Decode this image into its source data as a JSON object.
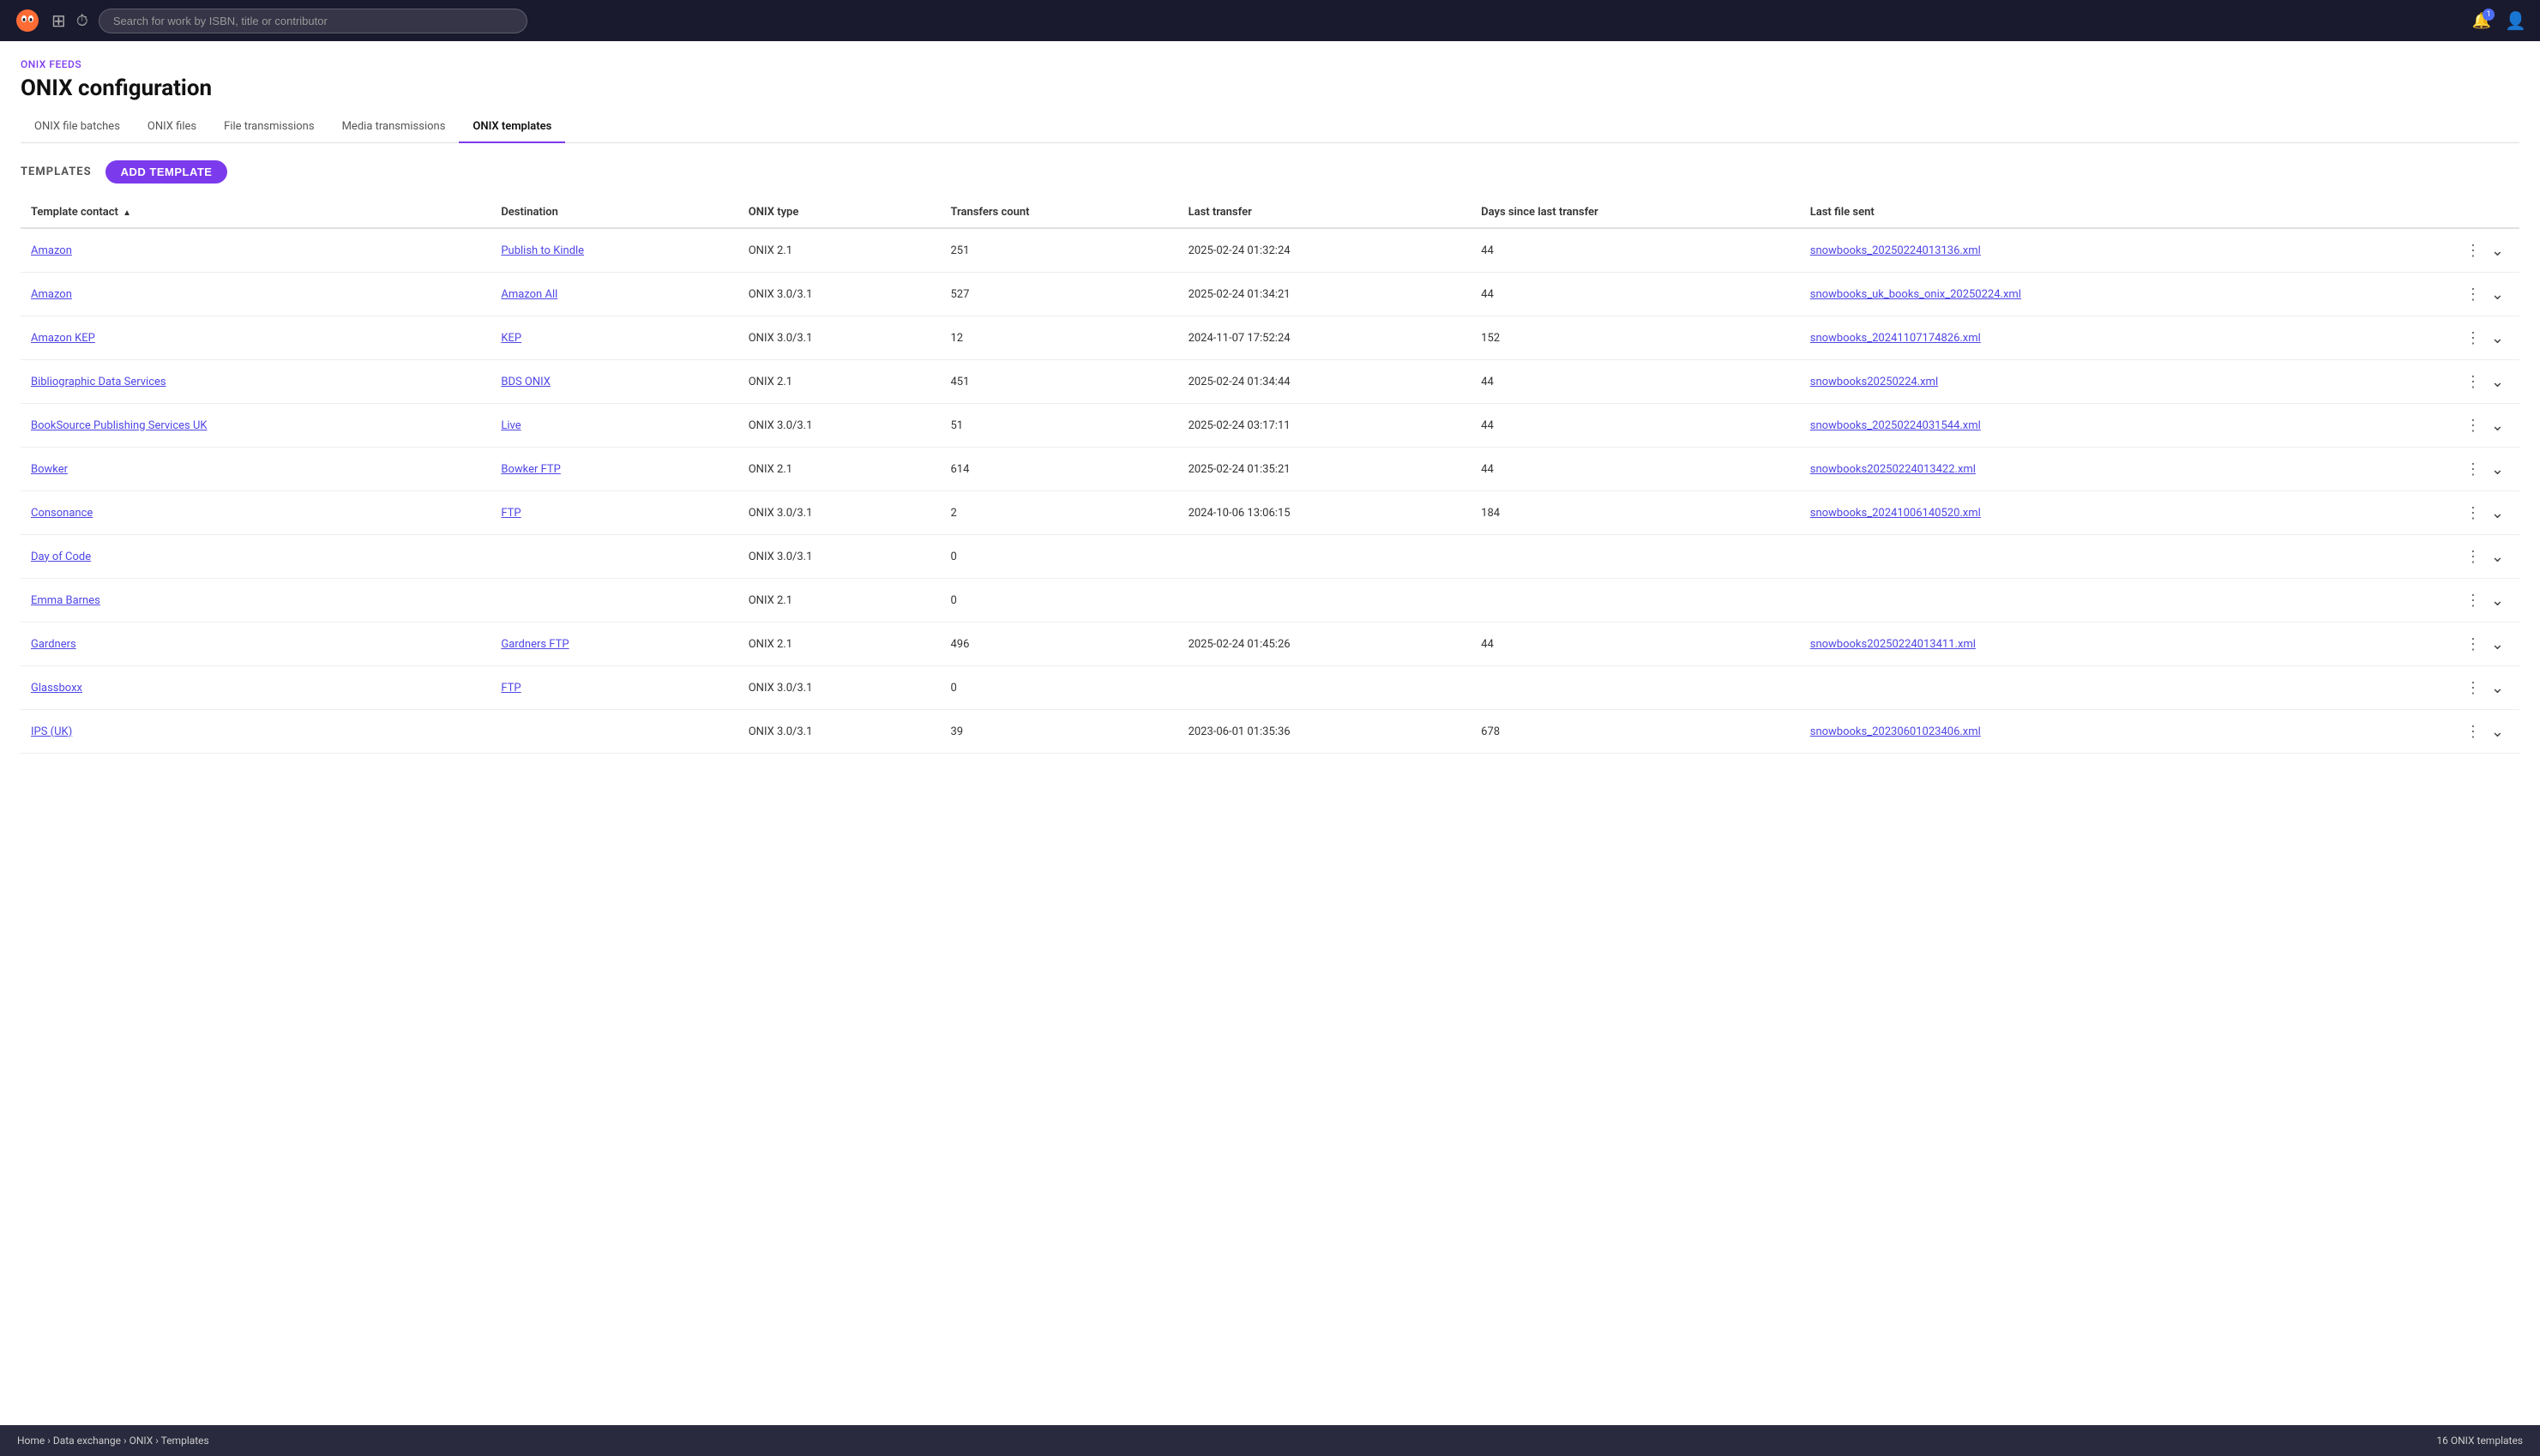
{
  "topNav": {
    "searchPlaceholder": "Search for work by ISBN, title or contributor",
    "bellBadge": "1"
  },
  "breadcrumb": "ONIX FEEDS",
  "pageTitle": "ONIX configuration",
  "subTabs": [
    {
      "label": "ONIX file batches",
      "active": false
    },
    {
      "label": "ONIX files",
      "active": false
    },
    {
      "label": "File transmissions",
      "active": false
    },
    {
      "label": "Media transmissions",
      "active": false
    },
    {
      "label": "ONIX templates",
      "active": true
    }
  ],
  "section": {
    "label": "TEMPLATES",
    "addButton": "ADD TEMPLATE"
  },
  "table": {
    "columns": [
      {
        "key": "contact",
        "label": "Template contact",
        "sortable": true
      },
      {
        "key": "destination",
        "label": "Destination"
      },
      {
        "key": "onixType",
        "label": "ONIX type"
      },
      {
        "key": "transfersCount",
        "label": "Transfers count"
      },
      {
        "key": "lastTransfer",
        "label": "Last transfer"
      },
      {
        "key": "daysSince",
        "label": "Days since last transfer"
      },
      {
        "key": "lastFileSent",
        "label": "Last file sent"
      }
    ],
    "rows": [
      {
        "contact": "Amazon",
        "contactLink": true,
        "destination": "Publish to Kindle",
        "destinationLink": true,
        "onixType": "ONIX 2.1",
        "transfersCount": "251",
        "lastTransfer": "2025-02-24 01:32:24",
        "daysSince": "44",
        "lastFileSent": "snowbooks_20250224013136.xml",
        "lastFileSentLink": true
      },
      {
        "contact": "Amazon",
        "contactLink": true,
        "destination": "Amazon All",
        "destinationLink": true,
        "onixType": "ONIX 3.0/3.1",
        "transfersCount": "527",
        "lastTransfer": "2025-02-24 01:34:21",
        "daysSince": "44",
        "lastFileSent": "snowbooks_uk_books_onix_20250224.xml",
        "lastFileSentLink": true
      },
      {
        "contact": "Amazon KEP",
        "contactLink": true,
        "destination": "KEP",
        "destinationLink": true,
        "onixType": "ONIX 3.0/3.1",
        "transfersCount": "12",
        "lastTransfer": "2024-11-07 17:52:24",
        "daysSince": "152",
        "lastFileSent": "snowbooks_20241107174826.xml",
        "lastFileSentLink": true
      },
      {
        "contact": "Bibliographic Data Services",
        "contactLink": true,
        "destination": "BDS ONIX",
        "destinationLink": true,
        "onixType": "ONIX 2.1",
        "transfersCount": "451",
        "lastTransfer": "2025-02-24 01:34:44",
        "daysSince": "44",
        "lastFileSent": "snowbooks20250224.xml",
        "lastFileSentLink": true
      },
      {
        "contact": "BookSource Publishing Services UK",
        "contactLink": true,
        "destination": "Live",
        "destinationLink": true,
        "onixType": "ONIX 3.0/3.1",
        "transfersCount": "51",
        "lastTransfer": "2025-02-24 03:17:11",
        "daysSince": "44",
        "lastFileSent": "snowbooks_20250224031544.xml",
        "lastFileSentLink": true
      },
      {
        "contact": "Bowker",
        "contactLink": true,
        "destination": "Bowker FTP",
        "destinationLink": true,
        "onixType": "ONIX 2.1",
        "transfersCount": "614",
        "lastTransfer": "2025-02-24 01:35:21",
        "daysSince": "44",
        "lastFileSent": "snowbooks20250224013422.xml",
        "lastFileSentLink": true
      },
      {
        "contact": "Consonance",
        "contactLink": true,
        "destination": "FTP",
        "destinationLink": true,
        "onixType": "ONIX 3.0/3.1",
        "transfersCount": "2",
        "lastTransfer": "2024-10-06 13:06:15",
        "daysSince": "184",
        "lastFileSent": "snowbooks_20241006140520.xml",
        "lastFileSentLink": true
      },
      {
        "contact": "Day of Code",
        "contactLink": true,
        "destination": "",
        "destinationLink": false,
        "onixType": "ONIX 3.0/3.1",
        "transfersCount": "0",
        "lastTransfer": "",
        "daysSince": "",
        "lastFileSent": "",
        "lastFileSentLink": false
      },
      {
        "contact": "Emma Barnes",
        "contactLink": true,
        "destination": "",
        "destinationLink": false,
        "onixType": "ONIX 2.1",
        "transfersCount": "0",
        "lastTransfer": "",
        "daysSince": "",
        "lastFileSent": "",
        "lastFileSentLink": false
      },
      {
        "contact": "Gardners",
        "contactLink": true,
        "destination": "Gardners FTP",
        "destinationLink": true,
        "onixType": "ONIX 2.1",
        "transfersCount": "496",
        "lastTransfer": "2025-02-24 01:45:26",
        "daysSince": "44",
        "lastFileSent": "snowbooks20250224013411.xml",
        "lastFileSentLink": true
      },
      {
        "contact": "Glassboxx",
        "contactLink": true,
        "destination": "FTP",
        "destinationLink": true,
        "onixType": "ONIX 3.0/3.1",
        "transfersCount": "0",
        "lastTransfer": "",
        "daysSince": "",
        "lastFileSent": "",
        "lastFileSentLink": false
      },
      {
        "contact": "IPS (UK)",
        "contactLink": true,
        "destination": "",
        "destinationLink": false,
        "onixType": "ONIX 3.0/3.1",
        "transfersCount": "39",
        "lastTransfer": "2023-06-01 01:35:36",
        "daysSince": "678",
        "lastFileSent": "snowbooks_20230601023406.xml",
        "lastFileSentLink": true
      }
    ]
  },
  "bottomBar": {
    "breadcrumb": "Home › Data exchange › ONIX › Templates",
    "count": "16 ONIX templates"
  }
}
